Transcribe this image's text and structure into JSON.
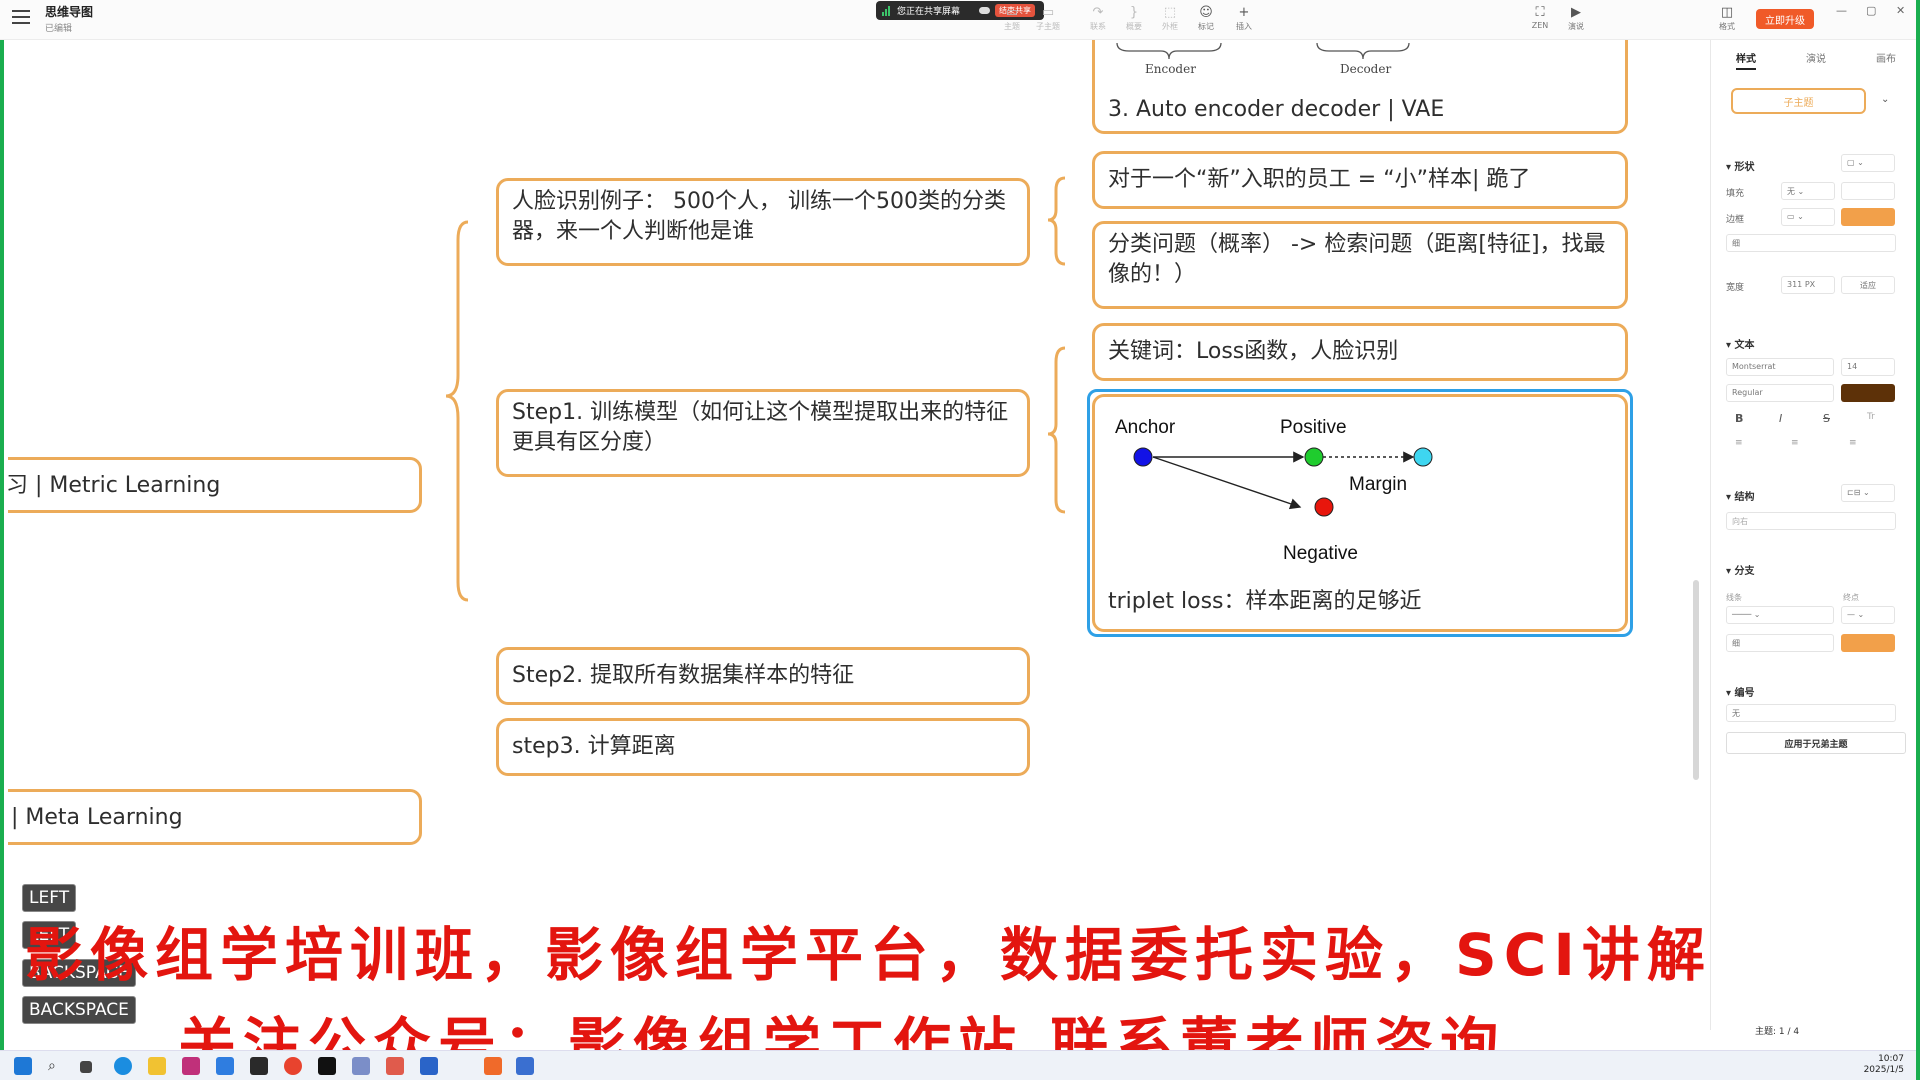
{
  "app": {
    "title": "思维导图",
    "subtitle": "已编辑"
  },
  "share": {
    "status": "您正在共享屏幕",
    "end_label": "结束共享"
  },
  "toolbar": {
    "items": [
      "主题",
      "子主题",
      "联系",
      "概要",
      "外框",
      "标记",
      "插入",
      "ZEN",
      "演说",
      "格式"
    ],
    "upgrade_label": "立即升级"
  },
  "mindmap": {
    "root_left_1": "习 | Metric Learning",
    "root_left_2": "| Meta Learning",
    "mid_1": "人脸识别例子： 500个人， 训练一个500类的分类器，来一个人判断他是谁",
    "mid_2": "Step1. 训练模型（如何让这个模型提取出来的特征更具有区分度）",
    "mid_3": "Step2. 提取所有数据集样本的特征",
    "mid_4": "step3. 计算距离",
    "right_vae": "3. Auto encoder decoder | VAE",
    "vae_encoder": "Encoder",
    "vae_decoder": "Decoder",
    "right_1": "对于一个“新”入职的员工 = “小”样本| 跪了",
    "right_2": "分类问题（概率） -> 检索问题（距离[特征]，找最像的！）",
    "right_3": "关键词：Loss函数，人脸识别",
    "triplet": {
      "anchor": "Anchor",
      "positive": "Positive",
      "margin": "Margin",
      "negative": "Negative",
      "caption": "triplet loss：样本距离的足够近",
      "colors": {
        "anchor": "#1212e6",
        "positive": "#1fcc2e",
        "negative": "#e8160c",
        "margin_point": "#3ed6f0"
      }
    }
  },
  "panel": {
    "tabs": [
      "样式",
      "演说",
      "画布"
    ],
    "style_preview": "子主题",
    "shape_section": "形状",
    "fill_label": "填充",
    "fill_value": "无",
    "border_label": "边框",
    "border_weight": "细",
    "width_label": "宽度",
    "width_value": "311",
    "width_unit": "PX",
    "fit_label": "适应",
    "text_section": "文本",
    "font_family": "Montserrat",
    "font_size": "14",
    "font_weight": "Regular",
    "structure_section": "结构",
    "structure_value": "向右",
    "branch_section": "分支",
    "line_label": "线条",
    "end_label": "终点",
    "branch_weight": "细",
    "numbering_section": "编号",
    "numbering_value": "无",
    "apply_label": "应用于兄弟主题",
    "accent": "#f2a04a",
    "text_color": "#5d3108"
  },
  "status": {
    "topic_count": "主题: 1 / 4"
  },
  "keys": [
    "LEFT",
    "LEFT",
    "BACKSPACE",
    "BACKSPACE"
  ],
  "banner": {
    "line1": "影像组学培训班，影像组学平台，数据委托实验，SCI讲解",
    "line2": "关注公众号：影像组学工作站   联系董老师咨询"
  },
  "clock": {
    "time": "10:07",
    "date": "2025/1/5"
  }
}
